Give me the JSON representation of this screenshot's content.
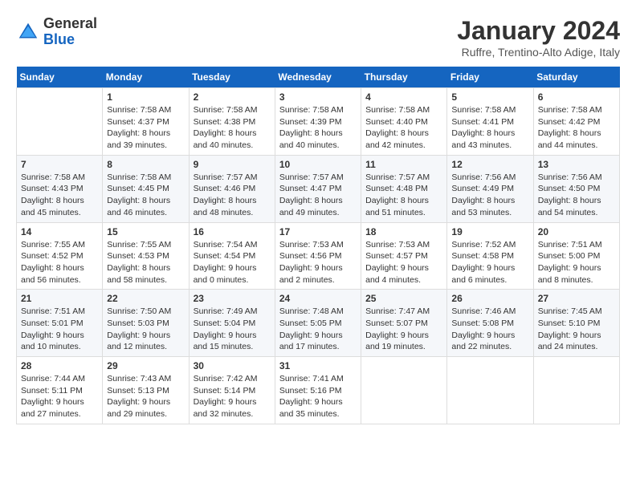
{
  "header": {
    "logo_line1": "General",
    "logo_line2": "Blue",
    "month": "January 2024",
    "location": "Ruffre, Trentino-Alto Adige, Italy"
  },
  "weekdays": [
    "Sunday",
    "Monday",
    "Tuesday",
    "Wednesday",
    "Thursday",
    "Friday",
    "Saturday"
  ],
  "weeks": [
    [
      {
        "day": "",
        "info": ""
      },
      {
        "day": "1",
        "info": "Sunrise: 7:58 AM\nSunset: 4:37 PM\nDaylight: 8 hours\nand 39 minutes."
      },
      {
        "day": "2",
        "info": "Sunrise: 7:58 AM\nSunset: 4:38 PM\nDaylight: 8 hours\nand 40 minutes."
      },
      {
        "day": "3",
        "info": "Sunrise: 7:58 AM\nSunset: 4:39 PM\nDaylight: 8 hours\nand 40 minutes."
      },
      {
        "day": "4",
        "info": "Sunrise: 7:58 AM\nSunset: 4:40 PM\nDaylight: 8 hours\nand 42 minutes."
      },
      {
        "day": "5",
        "info": "Sunrise: 7:58 AM\nSunset: 4:41 PM\nDaylight: 8 hours\nand 43 minutes."
      },
      {
        "day": "6",
        "info": "Sunrise: 7:58 AM\nSunset: 4:42 PM\nDaylight: 8 hours\nand 44 minutes."
      }
    ],
    [
      {
        "day": "7",
        "info": "Sunrise: 7:58 AM\nSunset: 4:43 PM\nDaylight: 8 hours\nand 45 minutes."
      },
      {
        "day": "8",
        "info": "Sunrise: 7:58 AM\nSunset: 4:45 PM\nDaylight: 8 hours\nand 46 minutes."
      },
      {
        "day": "9",
        "info": "Sunrise: 7:57 AM\nSunset: 4:46 PM\nDaylight: 8 hours\nand 48 minutes."
      },
      {
        "day": "10",
        "info": "Sunrise: 7:57 AM\nSunset: 4:47 PM\nDaylight: 8 hours\nand 49 minutes."
      },
      {
        "day": "11",
        "info": "Sunrise: 7:57 AM\nSunset: 4:48 PM\nDaylight: 8 hours\nand 51 minutes."
      },
      {
        "day": "12",
        "info": "Sunrise: 7:56 AM\nSunset: 4:49 PM\nDaylight: 8 hours\nand 53 minutes."
      },
      {
        "day": "13",
        "info": "Sunrise: 7:56 AM\nSunset: 4:50 PM\nDaylight: 8 hours\nand 54 minutes."
      }
    ],
    [
      {
        "day": "14",
        "info": "Sunrise: 7:55 AM\nSunset: 4:52 PM\nDaylight: 8 hours\nand 56 minutes."
      },
      {
        "day": "15",
        "info": "Sunrise: 7:55 AM\nSunset: 4:53 PM\nDaylight: 8 hours\nand 58 minutes."
      },
      {
        "day": "16",
        "info": "Sunrise: 7:54 AM\nSunset: 4:54 PM\nDaylight: 9 hours\nand 0 minutes."
      },
      {
        "day": "17",
        "info": "Sunrise: 7:53 AM\nSunset: 4:56 PM\nDaylight: 9 hours\nand 2 minutes."
      },
      {
        "day": "18",
        "info": "Sunrise: 7:53 AM\nSunset: 4:57 PM\nDaylight: 9 hours\nand 4 minutes."
      },
      {
        "day": "19",
        "info": "Sunrise: 7:52 AM\nSunset: 4:58 PM\nDaylight: 9 hours\nand 6 minutes."
      },
      {
        "day": "20",
        "info": "Sunrise: 7:51 AM\nSunset: 5:00 PM\nDaylight: 9 hours\nand 8 minutes."
      }
    ],
    [
      {
        "day": "21",
        "info": "Sunrise: 7:51 AM\nSunset: 5:01 PM\nDaylight: 9 hours\nand 10 minutes."
      },
      {
        "day": "22",
        "info": "Sunrise: 7:50 AM\nSunset: 5:03 PM\nDaylight: 9 hours\nand 12 minutes."
      },
      {
        "day": "23",
        "info": "Sunrise: 7:49 AM\nSunset: 5:04 PM\nDaylight: 9 hours\nand 15 minutes."
      },
      {
        "day": "24",
        "info": "Sunrise: 7:48 AM\nSunset: 5:05 PM\nDaylight: 9 hours\nand 17 minutes."
      },
      {
        "day": "25",
        "info": "Sunrise: 7:47 AM\nSunset: 5:07 PM\nDaylight: 9 hours\nand 19 minutes."
      },
      {
        "day": "26",
        "info": "Sunrise: 7:46 AM\nSunset: 5:08 PM\nDaylight: 9 hours\nand 22 minutes."
      },
      {
        "day": "27",
        "info": "Sunrise: 7:45 AM\nSunset: 5:10 PM\nDaylight: 9 hours\nand 24 minutes."
      }
    ],
    [
      {
        "day": "28",
        "info": "Sunrise: 7:44 AM\nSunset: 5:11 PM\nDaylight: 9 hours\nand 27 minutes."
      },
      {
        "day": "29",
        "info": "Sunrise: 7:43 AM\nSunset: 5:13 PM\nDaylight: 9 hours\nand 29 minutes."
      },
      {
        "day": "30",
        "info": "Sunrise: 7:42 AM\nSunset: 5:14 PM\nDaylight: 9 hours\nand 32 minutes."
      },
      {
        "day": "31",
        "info": "Sunrise: 7:41 AM\nSunset: 5:16 PM\nDaylight: 9 hours\nand 35 minutes."
      },
      {
        "day": "",
        "info": ""
      },
      {
        "day": "",
        "info": ""
      },
      {
        "day": "",
        "info": ""
      }
    ]
  ]
}
